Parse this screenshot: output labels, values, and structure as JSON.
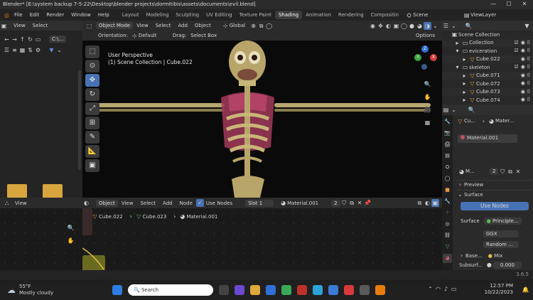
{
  "window": {
    "title": "Blender* [E:\\system backup 7-5-22\\Desktop\\blender projects\\dormitibis\\assets\\documents\\evil.blend]",
    "controls": [
      "—",
      "☐",
      "✕"
    ]
  },
  "menubar": {
    "menus": [
      "File",
      "Edit",
      "Render",
      "Window",
      "Help"
    ],
    "workspaces": [
      "Layout",
      "Modeling",
      "Sculpting",
      "UV Editing",
      "Texture Paint",
      "Shading",
      "Animation",
      "Rendering",
      "Compositin"
    ],
    "active_workspace": "Shading",
    "scene": "Scene",
    "view_layer": "ViewLayer"
  },
  "filebrowser": {
    "view_label": "View",
    "select_label": "Select",
    "path_label": "C:\\..."
  },
  "viewport": {
    "mode": "Object Mode",
    "menus": [
      "View",
      "Select",
      "Add",
      "Object"
    ],
    "orientation_label": "Orientation:",
    "orientation_value": "Default",
    "drag_label": "Drag:",
    "drag_value": "Select Box",
    "transform_space": "Global",
    "options_label": "Options",
    "overlay_title": "User Perspective",
    "overlay_subtitle": "(1) Scene Collection | Cube.022",
    "gizmo": {
      "x": "X",
      "y": "Y",
      "z": "Z"
    }
  },
  "outliner": {
    "root": "Scene Collection",
    "items": [
      {
        "name": "Collection",
        "level": 1
      },
      {
        "name": "eviceration",
        "level": 1
      },
      {
        "name": "Cube.022",
        "level": 2
      },
      {
        "name": "skeleton",
        "level": 1
      },
      {
        "name": "Cube.071",
        "level": 2
      },
      {
        "name": "Cube.072",
        "level": 2
      },
      {
        "name": "Cube.073",
        "level": 2
      },
      {
        "name": "Cube.074",
        "level": 2
      }
    ]
  },
  "properties": {
    "object_short": "Cu...",
    "material_short": "Mater...",
    "slot_material": "Material.001",
    "material_field": "M...",
    "user_count": "2",
    "preview_label": "Preview",
    "surface_label": "Surface",
    "use_nodes_label": "Use Nodes",
    "surface_field_label": "Surface",
    "surface_value": "Principle...",
    "distribution": "GGX",
    "subsurface_method": "Random ...",
    "base_label": "Base...",
    "base_value": "Mix",
    "subsurf_label": "Subsurf...",
    "subsurf_value": "0.000"
  },
  "node_editor": {
    "object_label": "Object",
    "menus": [
      "View",
      "Select",
      "Add",
      "Node"
    ],
    "use_nodes_label": "Use Nodes",
    "slot_label": "Slot 1",
    "material_name": "Material.001",
    "user_count": "2",
    "breadcrumb": [
      "Cube.022",
      "Cube.023",
      "Material.001"
    ]
  },
  "status": {
    "version": "3.6.5"
  },
  "taskbar": {
    "temperature": "55°F",
    "weather": "Mostly cloudy",
    "search_placeholder": "Search",
    "time": "12:57 PM",
    "date": "10/22/2023"
  },
  "colors": {
    "accent": "#4772b3",
    "viewport_bg": "#0a0a0a",
    "bone": "#c9b77a",
    "flesh": "#a23a5a"
  }
}
